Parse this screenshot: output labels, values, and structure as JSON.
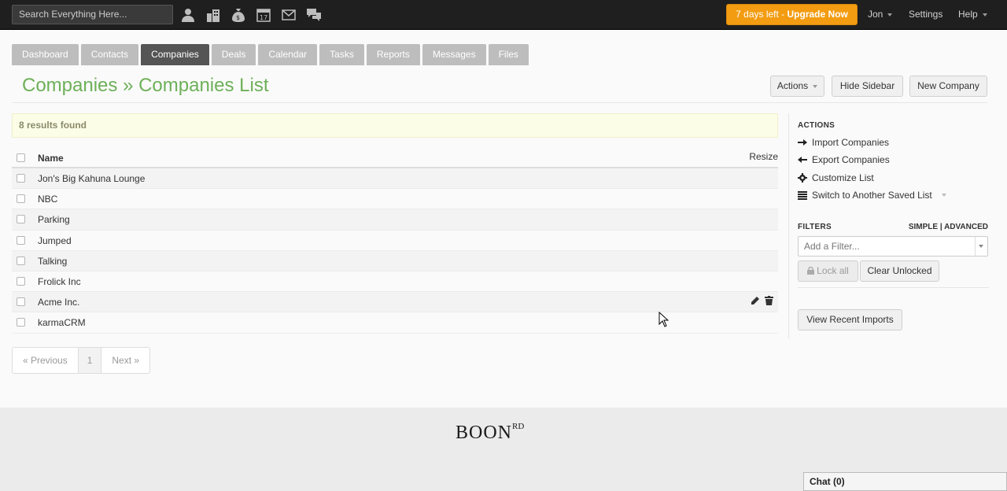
{
  "topbar": {
    "search_placeholder": "Search Everything Here...",
    "icons": [
      "person-icon",
      "buildings-icon",
      "money-bag-icon",
      "calendar-icon",
      "envelope-icon",
      "chat-bubbles-icon"
    ],
    "calendar_day": "17",
    "upgrade_prefix": "7 days left - ",
    "upgrade_action": "Upgrade Now",
    "upgrade_color": "#f39c12",
    "user": "Jon",
    "settings": "Settings",
    "help": "Help"
  },
  "tabs": [
    {
      "label": "Dashboard",
      "active": false
    },
    {
      "label": "Contacts",
      "active": false
    },
    {
      "label": "Companies",
      "active": true
    },
    {
      "label": "Deals",
      "active": false
    },
    {
      "label": "Calendar",
      "active": false
    },
    {
      "label": "Tasks",
      "active": false
    },
    {
      "label": "Reports",
      "active": false
    },
    {
      "label": "Messages",
      "active": false
    },
    {
      "label": "Files",
      "active": false
    }
  ],
  "page": {
    "title": "Companies » Companies List",
    "title_color": "#6db058",
    "actions_label": "Actions",
    "hide_sidebar_label": "Hide Sidebar",
    "new_company_label": "New Company"
  },
  "results": {
    "text": "8 results found"
  },
  "table": {
    "name_header": "Name",
    "resize_label": "Resize",
    "rows": [
      {
        "name": "Jon's Big Kahuna Lounge"
      },
      {
        "name": "NBC"
      },
      {
        "name": "Parking"
      },
      {
        "name": "Jumped"
      },
      {
        "name": "Talking"
      },
      {
        "name": "Frolick Inc"
      },
      {
        "name": "Acme Inc."
      },
      {
        "name": "karmaCRM"
      }
    ],
    "hovered_row_index": 6
  },
  "pagination": {
    "previous": "« Previous",
    "current": "1",
    "next": "Next »"
  },
  "sidebar": {
    "actions_heading": "ACTIONS",
    "import": "Import Companies",
    "export": "Export Companies",
    "customize": "Customize List",
    "switch_list": "Switch to Another Saved List",
    "filters_heading": "FILTERS",
    "simple": "SIMPLE",
    "advanced": "ADVANCED",
    "filter_separator": "|",
    "filter_placeholder": "Add a Filter...",
    "lock_all": "Lock all",
    "clear_unlocked": "Clear Unlocked",
    "view_recent_imports": "View Recent Imports"
  },
  "footer": {
    "logo_main": "BOON",
    "logo_sup": "RD",
    "chat": "Chat (0)"
  }
}
